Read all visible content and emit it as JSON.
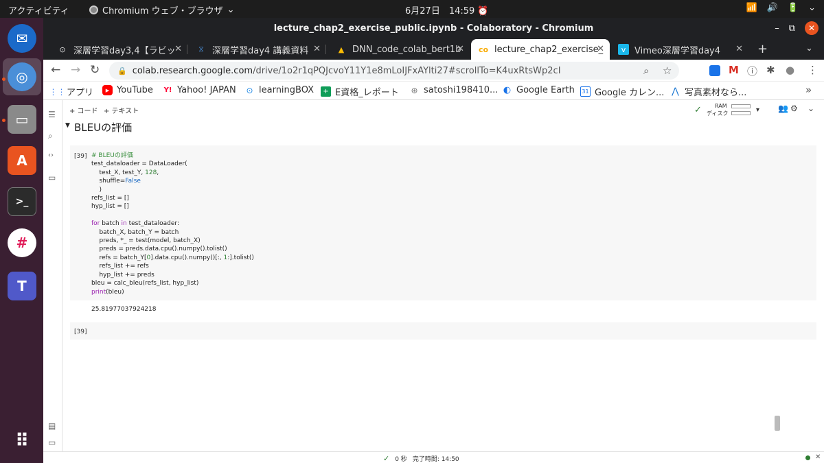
{
  "topbar": {
    "activities": "アクティビティ",
    "app_name": "Chromium ウェブ・ブラウザ",
    "app_chevron": "⌄",
    "clock": "6月27日　14:59",
    "alarm": "⏰",
    "tray": {
      "wifi": "📶",
      "volume": "🔊",
      "battery": "🔋",
      "menu": "⌄"
    }
  },
  "window": {
    "title": "lecture_chap2_exercise_public.ipynb - Colaboratory - Chromium",
    "minimize": "–",
    "maximize": "⧉",
    "close": "✕"
  },
  "tabs": [
    {
      "label": "深層学習day3,4【ラビッ",
      "icon": "⊙",
      "close": "✕"
    },
    {
      "label": "深層学習day4 講義資料",
      "icon": "⧖",
      "close": "✕"
    },
    {
      "label": "DNN_code_colab_bert1b",
      "icon": "▲",
      "close": "✕"
    },
    {
      "label": "lecture_chap2_exercise_",
      "icon": "co",
      "close": "✕"
    },
    {
      "label": "Vimeo深層学習day4",
      "icon": "v",
      "close": "✕"
    }
  ],
  "new_tab": "+",
  "tab_menu": "⌄",
  "nav": {
    "back": "←",
    "forward": "→",
    "reload": "↻"
  },
  "omnibox": {
    "lock": "🔒",
    "url_host": "colab.research.google.com",
    "url_path": "/drive/1o2r1qPQJcvoY11Y1e8mLoIJFxAYlti27#scrollTo=K4uxRtsWp2cI",
    "zoom": "⌕",
    "star": "☆"
  },
  "extensions": {
    "mail": "M",
    "info": "ⓘ",
    "puzzle": "✱",
    "profile": "●",
    "menu": "⋮"
  },
  "bookmarks": [
    {
      "label": "アプリ",
      "icon": "⋮⋮",
      "color": "#4285f4"
    },
    {
      "label": "YouTube",
      "icon": "▶",
      "color": "#ff0000"
    },
    {
      "label": "Yahoo! JAPAN",
      "icon": "Y!",
      "color": "#ff0033"
    },
    {
      "label": "learningBOX",
      "icon": "⊙",
      "color": "#1e88e5"
    },
    {
      "label": "E資格_レポート",
      "icon": "+",
      "color": "#0f9d58"
    },
    {
      "label": "satoshi198410...",
      "icon": "⊛",
      "color": "#777777"
    },
    {
      "label": "Google Earth",
      "icon": "◐",
      "color": "#1a73e8"
    },
    {
      "label": "Google カレン...",
      "icon": "31",
      "color": "#1a73e8"
    },
    {
      "label": "写真素材なら...",
      "icon": "⋀",
      "color": "#1976d2"
    }
  ],
  "bookmarks_more": "»",
  "colab": {
    "add_code": "+ コード",
    "add_text": "+ テキスト",
    "ram_label": "RAM",
    "disk_label": "ディスク",
    "check": "✓",
    "dropdown": "▾",
    "share_icon": "👥",
    "settings_icon": "⚙",
    "collapse_icon": "⌄",
    "left_icons": {
      "toc": "☰",
      "search": "⌕",
      "code": "‹›",
      "files": "▭",
      "bottom1": "▤",
      "bottom2": "▭"
    }
  },
  "section": {
    "chevron": "▼",
    "title": "BLEUの評価"
  },
  "cell1": {
    "number": "[39]",
    "lines": [
      [
        {
          "t": "# BLEUの評価",
          "c": "cm"
        }
      ],
      [
        {
          "t": "test_dataloader = DataLoader(",
          "c": ""
        }
      ],
      [
        {
          "t": "    test_X, test_Y, ",
          "c": ""
        },
        {
          "t": "128",
          "c": "nm"
        },
        {
          "t": ",",
          "c": ""
        }
      ],
      [
        {
          "t": "    shuffle=",
          "c": ""
        },
        {
          "t": "False",
          "c": "cn"
        }
      ],
      [
        {
          "t": "    )",
          "c": ""
        }
      ],
      [
        {
          "t": "refs_list = []",
          "c": ""
        }
      ],
      [
        {
          "t": "hyp_list = []",
          "c": ""
        }
      ],
      [
        {
          "t": "",
          "c": ""
        }
      ],
      [
        {
          "t": "for",
          "c": "kw"
        },
        {
          "t": " batch ",
          "c": ""
        },
        {
          "t": "in",
          "c": "kw"
        },
        {
          "t": " test_dataloader:",
          "c": ""
        }
      ],
      [
        {
          "t": "    batch_X, batch_Y = batch",
          "c": ""
        }
      ],
      [
        {
          "t": "    preds, *_ = test(model, batch_X)",
          "c": ""
        }
      ],
      [
        {
          "t": "    preds = preds.data.cpu().numpy().tolist()",
          "c": ""
        }
      ],
      [
        {
          "t": "    refs = batch_Y[",
          "c": ""
        },
        {
          "t": "0",
          "c": "nm"
        },
        {
          "t": "].data.cpu().numpy()[:, ",
          "c": ""
        },
        {
          "t": "1",
          "c": "nm"
        },
        {
          "t": ":].tolist()",
          "c": ""
        }
      ],
      [
        {
          "t": "    refs_list += refs",
          "c": ""
        }
      ],
      [
        {
          "t": "    hyp_list += preds",
          "c": ""
        }
      ],
      [
        {
          "t": "bleu = calc_bleu(refs_list, hyp_list)",
          "c": ""
        }
      ],
      [
        {
          "t": "print",
          "c": "kw"
        },
        {
          "t": "(bleu)",
          "c": ""
        }
      ]
    ],
    "output": "25.81977037924218"
  },
  "cell2": {
    "number": "[39]"
  },
  "statusbar": {
    "check": "✓",
    "elapsed": "0 秒",
    "completed": "完了時間: 14:50",
    "close": "✕"
  },
  "dock": [
    {
      "name": "thunderbird",
      "glyph": "✉",
      "color": "#1b6ac9"
    },
    {
      "name": "chromium",
      "glyph": "◎",
      "color": "#4a8fd8"
    },
    {
      "name": "files",
      "glyph": "▭",
      "color": "#8a8a8a"
    },
    {
      "name": "software",
      "glyph": "A",
      "color": "#e95420"
    },
    {
      "name": "terminal",
      "glyph": ">_",
      "color": "#2b2b2b"
    },
    {
      "name": "slack",
      "glyph": "#",
      "color": "#ffffff"
    },
    {
      "name": "teams",
      "glyph": "T",
      "color": "#5059c9"
    },
    {
      "name": "app-grid",
      "glyph": "⠿",
      "color": "transparent"
    }
  ]
}
